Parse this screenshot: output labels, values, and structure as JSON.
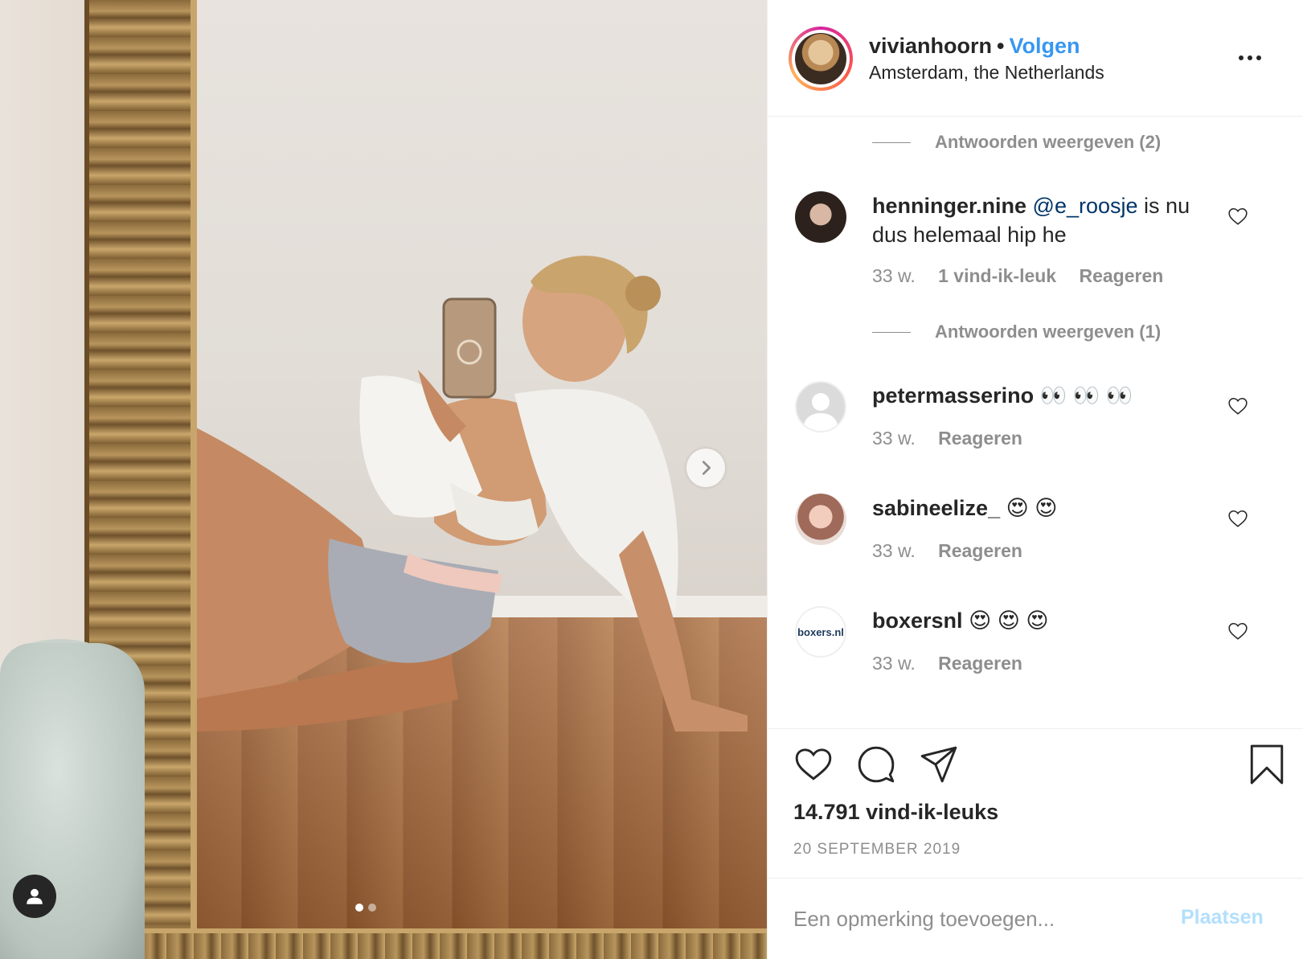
{
  "post": {
    "username": "vivianhoorn",
    "separator": "•",
    "follow_label": "Volgen",
    "location": "Amsterdam, the Netherlands",
    "more_icon": "more-options-icon"
  },
  "comments": [
    {
      "username": "henninger.nine",
      "mention": "@e_roosje",
      "text": "is nu dus helemaal hip he",
      "age": "33 w.",
      "likes": "1 vind-ik-leuk",
      "reply_label": "Reageren"
    },
    {
      "username": "petermasserino",
      "text": "👀 👀 👀",
      "age": "33 w.",
      "reply_label": "Reageren"
    },
    {
      "username": "sabineelize_",
      "text": "😍 😍",
      "age": "33 w.",
      "reply_label": "Reageren"
    },
    {
      "username": "boxersnl",
      "avatar_text": "boxers.nl",
      "text": "😍 😍 😍",
      "age": "33 w.",
      "reply_label": "Reageren"
    }
  ],
  "replies_toggles": [
    "Antwoorden weergeven (2)",
    "Antwoorden weergeven (1)"
  ],
  "footer": {
    "likes_count": "14.791 vind-ik-leuks",
    "date": "20 SEPTEMBER 2019",
    "comment_placeholder": "Een opmerking toevoegen...",
    "post_label": "Plaatsen"
  },
  "colors": {
    "link_blue": "#3897f0",
    "mention_blue": "#003569",
    "muted": "#8e8e8e",
    "post_disabled": "#b2dffc"
  },
  "carousel": {
    "current_slide": 1,
    "total_slides": 2
  }
}
